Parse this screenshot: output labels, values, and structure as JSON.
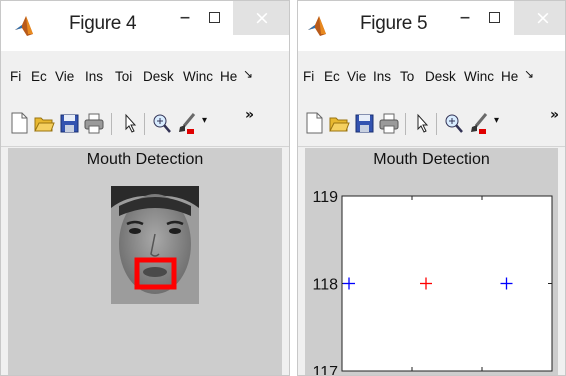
{
  "colors": {
    "accent_red": "#ff0000",
    "marker_blue": "#0000ff",
    "figure_bg": "#cdcdcd",
    "close_bg": "#e2e2e2"
  },
  "window4": {
    "title": "Figure 4",
    "minimize_glyph": "–",
    "close_glyph": "×",
    "menus": [
      "Fi",
      "Ec",
      "Vie",
      "Ins",
      "Toi",
      "Desk",
      "Winc",
      "He"
    ],
    "menu_more": "↘",
    "toolbar_more": "»",
    "axes_title": "Mouth Detection"
  },
  "window5": {
    "title": "Figure 5",
    "minimize_glyph": "–",
    "close_glyph": "×",
    "menus": [
      "Fi",
      "Ec",
      "Vie",
      "Ins",
      "To",
      "Desk",
      "Winc",
      "He"
    ],
    "menu_more": "↘",
    "toolbar_more": "»",
    "axes_title": "Mouth Detection"
  },
  "chart_data": {
    "type": "scatter",
    "title": "Mouth Detection",
    "xlabel": "",
    "ylabel": "",
    "xlim": [
      20,
      80
    ],
    "ylim": [
      117,
      119
    ],
    "xticks": [
      "20",
      "40",
      "60",
      "80"
    ],
    "yticks": [
      "117",
      "118",
      "119"
    ],
    "marker": "+",
    "points": [
      {
        "x": 22,
        "y": 118,
        "color": "#0000ff"
      },
      {
        "x": 44,
        "y": 118,
        "color": "#ff0000"
      },
      {
        "x": 67,
        "y": 118,
        "color": "#0000ff"
      }
    ],
    "grid": false
  }
}
